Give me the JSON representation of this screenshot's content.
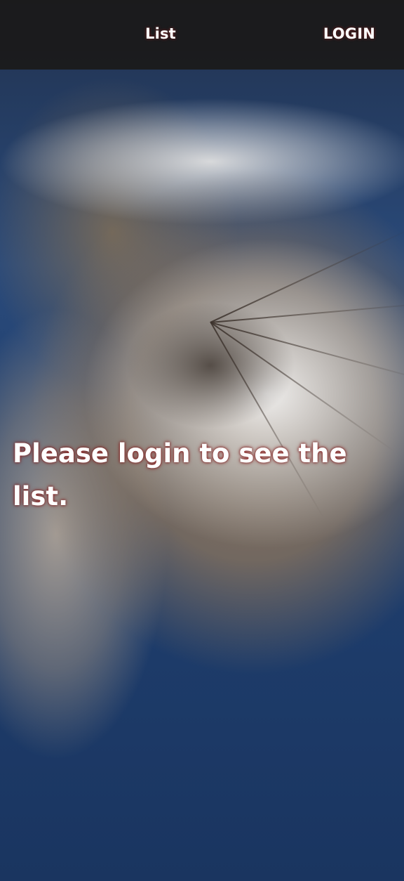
{
  "nav": {
    "list_label": "List",
    "login_label": "LOGIN"
  },
  "main": {
    "message": "Please login to see the list."
  },
  "background": {
    "image": "volcano-satellite-photo"
  }
}
